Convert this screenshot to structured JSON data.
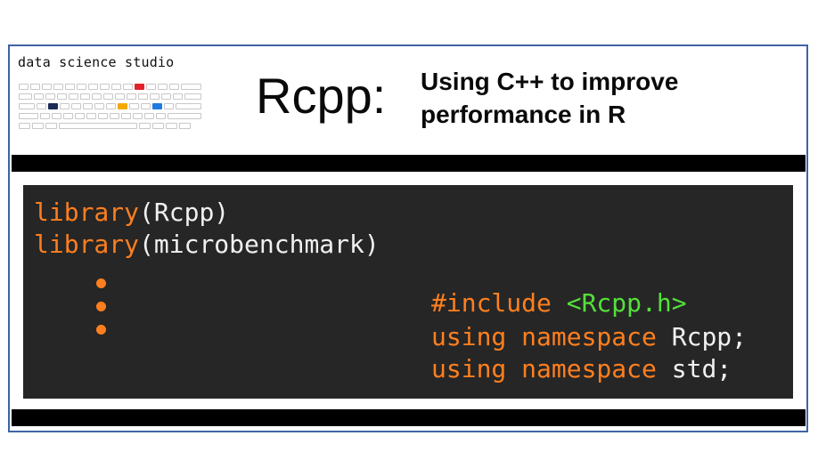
{
  "brand": {
    "text": "data science studio"
  },
  "title": {
    "main": "Rcpp:",
    "subtitle_line1": "Using C++ to improve",
    "subtitle_line2": "performance in  R"
  },
  "r_code": {
    "line1_fn": "library",
    "line1_arg": "(Rcpp)",
    "line2_fn": "library",
    "line2_arg": "(microbenchmark)"
  },
  "cpp_code": {
    "include_kw": "#include",
    "include_hdr": "<Rcpp.h>",
    "line2_kw": "using namespace",
    "line2_name": "Rcpp;",
    "line3_kw": "using namespace",
    "line3_name": "std;"
  },
  "colors": {
    "keyword": "#ff7f1f",
    "plain": "#f0f0f0",
    "header": "#54e03a",
    "panel": "#262626",
    "frame": "#3e64a6"
  }
}
